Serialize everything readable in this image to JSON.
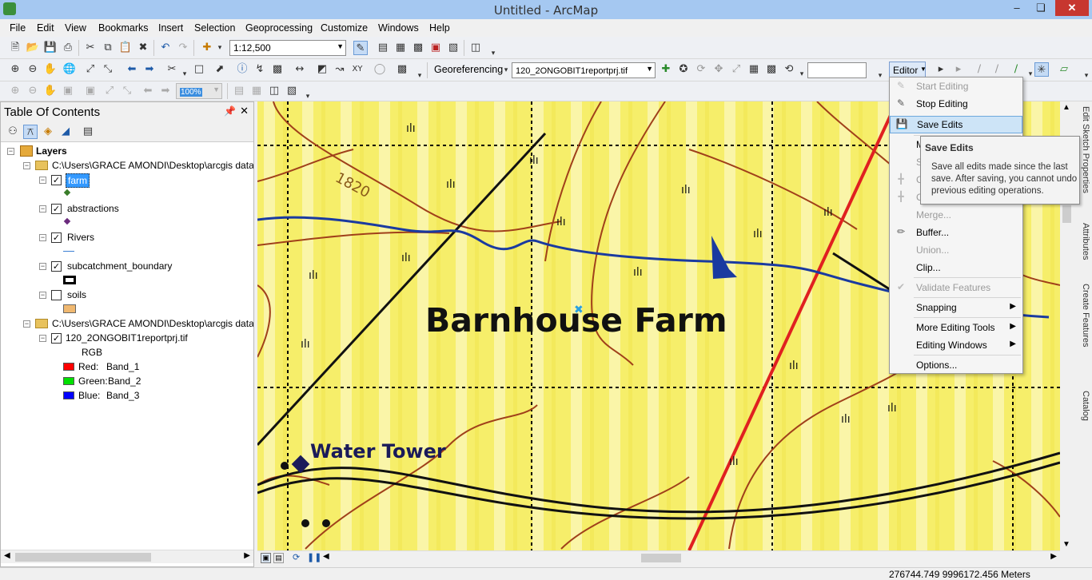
{
  "window": {
    "title": "Untitled - ArcMap",
    "min_icon": "minimize-icon",
    "max_icon": "maximize-icon",
    "close_icon": "close-icon"
  },
  "menubar": {
    "items": [
      "File",
      "Edit",
      "View",
      "Bookmarks",
      "Insert",
      "Selection",
      "Geoprocessing",
      "Customize",
      "Windows",
      "Help"
    ]
  },
  "toolbar": {
    "scale": "1:12,500",
    "georeferencing_label": "Georeferencing",
    "raster_layer": "120_2ONGOBIT1reportprj.tif",
    "zoom_percent": "100%",
    "editor_label": "Editor"
  },
  "toc": {
    "title": "Table Of Contents",
    "root": "Layers",
    "group1_path": "C:\\Users\\GRACE AMONDI\\Desktop\\arcgis datas",
    "layers": [
      {
        "name": "farm",
        "checked": true,
        "selected": true,
        "symbol_color": "#3a7d2a"
      },
      {
        "name": "abstractions",
        "checked": true,
        "selected": false,
        "symbol_color": "#6b2a7d"
      },
      {
        "name": "Rivers",
        "checked": true,
        "selected": false,
        "symbol_color": "#3b7fd4"
      },
      {
        "name": "subcatchment_boundary",
        "checked": true,
        "selected": false,
        "symbol_color": "#000000"
      },
      {
        "name": "soils",
        "checked": false,
        "selected": false,
        "symbol_color": "#f0b870"
      }
    ],
    "group2_path": "C:\\Users\\GRACE AMONDI\\Desktop\\arcgis datas",
    "raster": {
      "name": "120_2ONGOBIT1reportprj.tif",
      "checked": true,
      "mode": "RGB",
      "bands": [
        {
          "label": "Red:",
          "band": "Band_1",
          "color": "#ff0000"
        },
        {
          "label": "Green:",
          "band": "Band_2",
          "color": "#00e000"
        },
        {
          "label": "Blue:",
          "band": "Band_3",
          "color": "#0000ff"
        }
      ]
    }
  },
  "map": {
    "labels": {
      "farm": "Barnhouse Farm",
      "tower": "Water Tower",
      "contour": "1820"
    }
  },
  "editor_menu": {
    "items": [
      {
        "label": "Start Editing",
        "disabled": true,
        "icon": "start-editing-icon"
      },
      {
        "label": "Stop Editing",
        "disabled": false,
        "icon": "stop-editing-icon"
      },
      {
        "label": "Save Edits",
        "disabled": false,
        "highlighted": true,
        "icon": "save-edits-icon"
      },
      {
        "label": "Merge...",
        "disabled": true
      },
      {
        "label": "Buffer...",
        "disabled": false,
        "icon": "buffer-icon"
      },
      {
        "label": "Union...",
        "disabled": true
      },
      {
        "label": "Clip...",
        "disabled": false
      },
      {
        "label": "Validate Features",
        "disabled": true,
        "icon": "validate-icon"
      },
      {
        "label": "Snapping",
        "submenu": true
      },
      {
        "label": "More Editing Tools",
        "submenu": true
      },
      {
        "label": "Editing Windows",
        "submenu": true
      },
      {
        "label": "Options..."
      }
    ],
    "partial_rows": [
      "M",
      "S",
      "C",
      "C"
    ]
  },
  "tooltip": {
    "title": "Save Edits",
    "body": "Save all edits made since the last save. After saving, you cannot undo previous editing operations."
  },
  "right_dock": {
    "tabs": [
      "Edit Sketch Properties",
      "Attributes",
      "Create Features",
      "Catalog"
    ]
  },
  "status": {
    "coordinates": "276744.749  9996172.456 Meters"
  }
}
